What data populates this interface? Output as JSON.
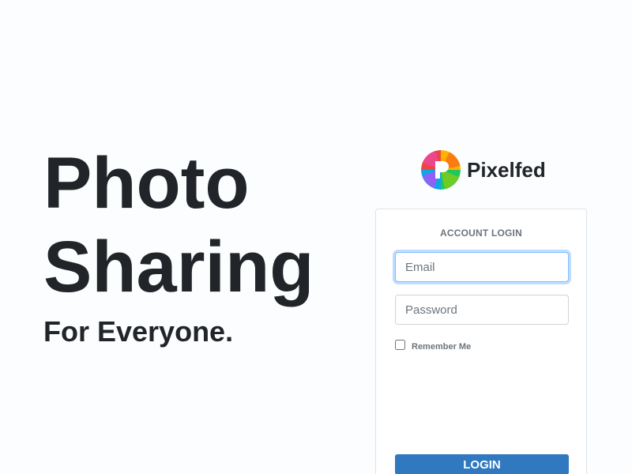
{
  "hero": {
    "line1": "Photo",
    "line2": "Sharing",
    "tagline": "For Everyone."
  },
  "brand": {
    "name": "Pixelfed",
    "logo_icon": "pixelfed-logo-icon"
  },
  "login_card": {
    "title": "ACCOUNT LOGIN",
    "email": {
      "value": "",
      "placeholder": "Email"
    },
    "password": {
      "value": "",
      "placeholder": "Password"
    },
    "remember_me_label": "Remember Me",
    "remember_me_checked": false,
    "login_button_label": "LOGIN"
  },
  "colors": {
    "page_background": "#fcfdfe",
    "primary_button": "#3079c0",
    "focus_ring": "#80bdff",
    "text_dark": "#212529",
    "text_muted": "#6c757d"
  }
}
